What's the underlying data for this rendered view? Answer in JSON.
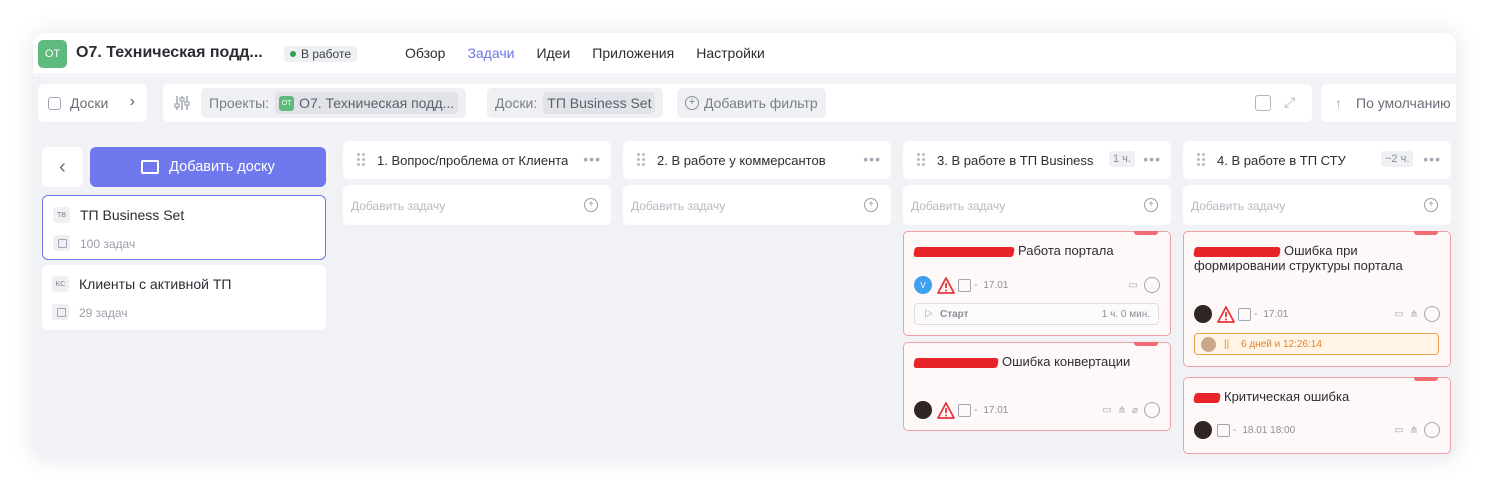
{
  "project": {
    "avatar": "ОТ",
    "title": "О7. Техническая подд...",
    "status": "В работе",
    "colors": {
      "avatar": "#5fba7d",
      "status_dot": "#2ea04f",
      "accent": "#6d75e4"
    }
  },
  "nav": {
    "tabs": [
      {
        "label": "Обзор",
        "active": false
      },
      {
        "label": "Задачи",
        "active": true
      },
      {
        "label": "Идеи",
        "active": false
      },
      {
        "label": "Приложения",
        "active": false
      },
      {
        "label": "Настройки",
        "active": false
      }
    ]
  },
  "filterbar": {
    "boards_label": "Доски",
    "projects_label": "Проекты:",
    "projects_value_avatar": "ОТ",
    "projects_value": "О7. Техническая подд...",
    "boards_filter_label": "Доски:",
    "boards_filter_value": "ТП Business Set",
    "add_filter": "Добавить фильтр",
    "sort_label": "По умолчанию"
  },
  "sidebar": {
    "add_board": "Добавить доску",
    "boards": [
      {
        "abbr": "TB",
        "name": "ТП Business Set",
        "count": "100 задач",
        "selected": true
      },
      {
        "abbr": "KC",
        "name": "Клиенты с активной ТП",
        "count": "29 задач",
        "selected": false
      }
    ]
  },
  "board": {
    "add_task_placeholder": "Добавить задачу",
    "columns": [
      {
        "title": "1. Вопрос/проблема от Клиента",
        "estimate": ""
      },
      {
        "title": "2. В работе у коммерсантов",
        "estimate": ""
      },
      {
        "title": "3. В работе в ТП Business",
        "estimate": "1 ч."
      },
      {
        "title": "4. В работе в ТП СТУ",
        "estimate": "~2 ч."
      }
    ],
    "tasks": {
      "c3t1": {
        "title": "Работа портала",
        "date": "17.01",
        "avatar": "V",
        "start_label": "Старт",
        "start_time": "1 ч. 0 мин."
      },
      "c3t2": {
        "title": "Ошибка конвертации",
        "date": "17.01"
      },
      "c4t1": {
        "title": "Ошибка при формировании структуры портала",
        "date": "17.01",
        "timer": "6 дней и 12:26:14"
      },
      "c4t2": {
        "title": "Критическая ошибка",
        "date": "18.01 18:00"
      }
    }
  }
}
